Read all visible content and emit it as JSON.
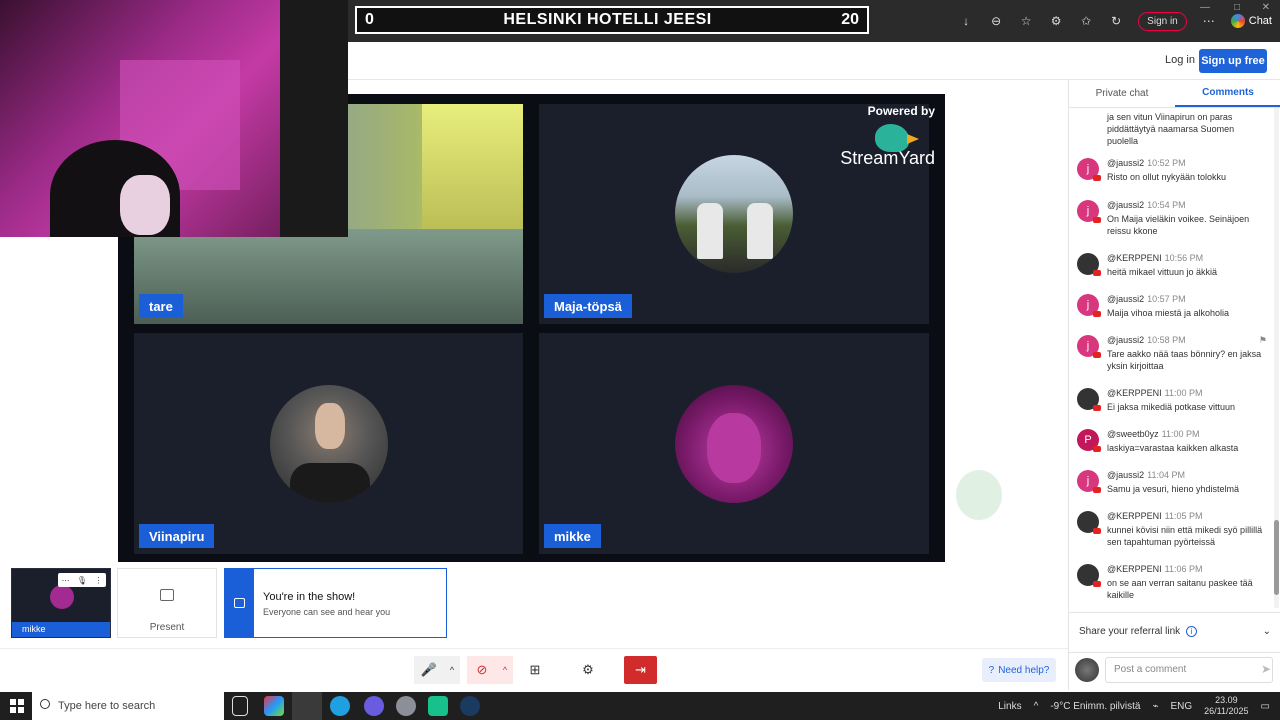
{
  "browser": {
    "sign_in_label": "Sign in",
    "chat_label": "Chat"
  },
  "scoreboard": {
    "left_score": "0",
    "title": "HELSINKI HOTELLI JEESI",
    "right_score": "20"
  },
  "header": {
    "login": "Log in",
    "signup": "Sign up free"
  },
  "stage": {
    "powered_by": "Powered by",
    "brand": "StreamYard",
    "participants": [
      {
        "name": "tare"
      },
      {
        "name": "Maja-töpsä"
      },
      {
        "name": "Viinapiru"
      },
      {
        "name": "mikke"
      }
    ]
  },
  "chat": {
    "tabs": [
      {
        "label": "Private chat",
        "active": false
      },
      {
        "label": "Comments",
        "active": true
      }
    ],
    "partial_first": "ja sen vitun Viinapirun on paras piddättäytyä naamarsa Suomen puolella",
    "messages": [
      {
        "author": "@jaussi2",
        "time": "10:52 PM",
        "text": "Risto on ollut nykyään tolokku",
        "initial": "j",
        "color": "#d9377d"
      },
      {
        "author": "@jaussi2",
        "time": "10:54 PM",
        "text": "On Maija vieläkin voikee. Seinäjoen reissu kkone",
        "initial": "j",
        "color": "#d9377d"
      },
      {
        "author": "@KERPPENI",
        "time": "10:56 PM",
        "text": "heitä mikael vittuun jo äkkiä",
        "initial": "",
        "color": "#333333"
      },
      {
        "author": "@jaussi2",
        "time": "10:57 PM",
        "text": "Maija vihoa miestä ja alkoholia",
        "initial": "j",
        "color": "#d9377d"
      },
      {
        "author": "@jaussi2",
        "time": "10:58 PM",
        "text": "Tare aakko nää taas bönniry? en jaksa yksin kirjoittaa",
        "initial": "j",
        "color": "#d9377d"
      },
      {
        "author": "@KERPPENI",
        "time": "11:00 PM",
        "text": "Ei jaksa mikediä potkase vittuun",
        "initial": "",
        "color": "#333333"
      },
      {
        "author": "@sweetb0yz",
        "time": "11:00 PM",
        "text": "laskiya=varastaa kaikken alkasta",
        "initial": "P",
        "color": "#c2185b"
      },
      {
        "author": "@jaussi2",
        "time": "11:04 PM",
        "text": "Samu ja vesuri, hieno yhdistelmä",
        "initial": "j",
        "color": "#d9377d"
      },
      {
        "author": "@KERPPENI",
        "time": "11:05 PM",
        "text": "kunnei kövisi niin että mikedi syö pillillä sen tapahtuman pyörteissä",
        "initial": "",
        "color": "#333333"
      },
      {
        "author": "@KERPPENI",
        "time": "11:06 PM",
        "text": "on se aan verran saitanu paskee tää kaikille",
        "initial": "",
        "color": "#333333"
      }
    ],
    "referral": "Share your referral link",
    "post_placeholder": "Post a comment"
  },
  "bottom": {
    "self_name": "mikke",
    "present": "Present",
    "banner_title": "You're in the show!",
    "banner_sub": "Everyone can see and hear you",
    "help": "Need help?"
  },
  "taskbar": {
    "search": "Type here to search",
    "links": "Links",
    "weather": "-9°C  Enimm. pilvistä",
    "lang": "ENG",
    "time": "23.09",
    "date": "26/11/2025"
  }
}
